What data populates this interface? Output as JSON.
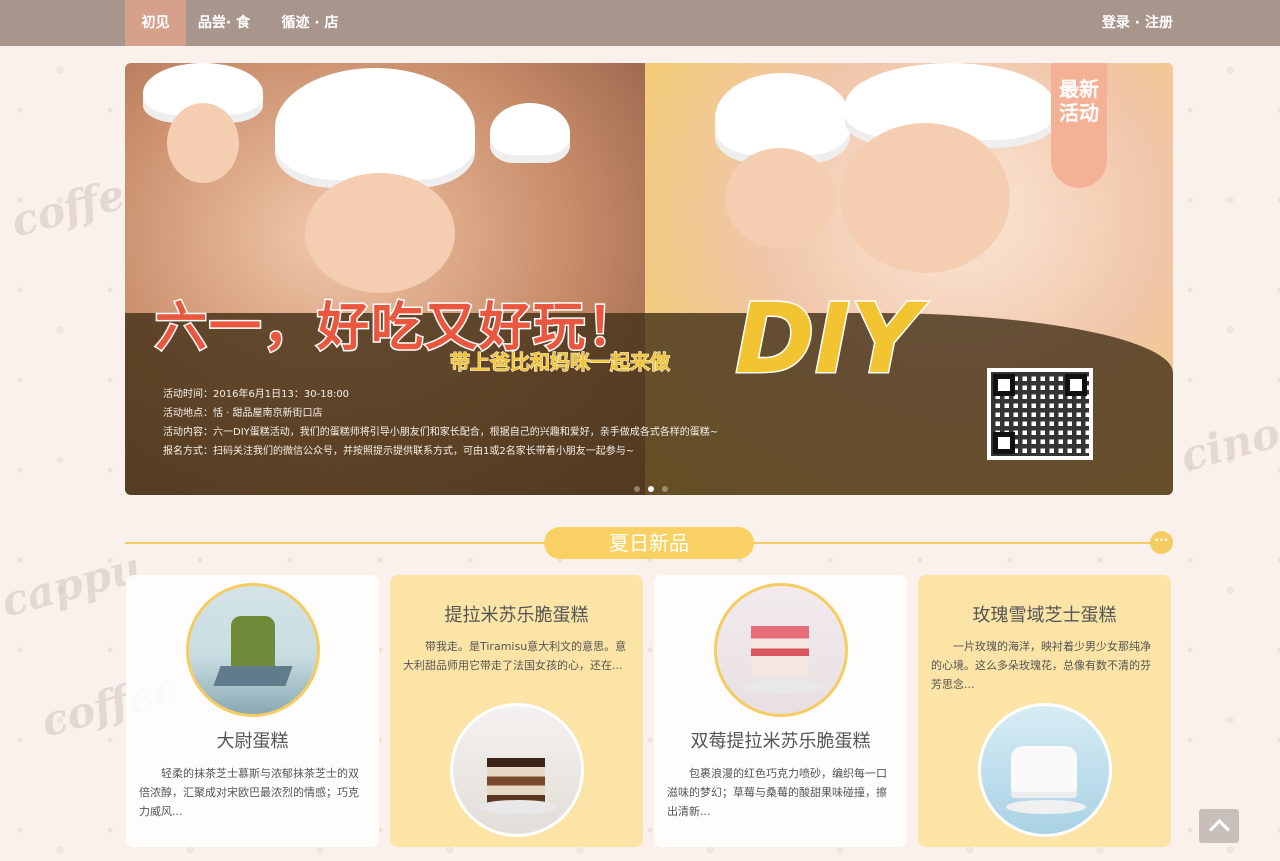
{
  "nav": {
    "items": [
      {
        "label": "初见",
        "active": true
      },
      {
        "label": "品尝· 食",
        "active": false
      },
      {
        "label": "循迹 · 店",
        "active": false
      }
    ],
    "login": "登录",
    "separator": " · ",
    "register": "注册"
  },
  "banner": {
    "badge": "最新活动",
    "headline": "六一，好吃又好玩！",
    "diy": "DIY",
    "subtitle": "带上爸比和妈咪一起来做",
    "info": [
      "活动时间：2016年6月1日13：30-18:00",
      "活动地点：恬 · 甜品屋南京新街口店",
      "活动内容：六一DIY蛋糕活动，我们的蛋糕师将引导小朋友们和家长配合，根据自己的兴趣和爱好，亲手做成各式各样的蛋糕~",
      "报名方式：扫码关注我们的微信公众号，并按照提示提供联系方式，可由1或2名家长带着小朋友一起参与~"
    ],
    "slide_count": 3,
    "active_slide": 2
  },
  "section": {
    "title": "夏日新品",
    "more": "···"
  },
  "products": [
    {
      "title": "大尉蛋糕",
      "desc": "轻柔的抹茶芝士慕斯与浓郁抹茶芝士的双倍浓醇，汇聚成对宋欧巴最浓烈的情感；巧克力威风..."
    },
    {
      "title": "提拉米苏乐脆蛋糕",
      "desc": "带我走。是Tiramisu意大利文的意思。意大利甜品师用它带走了法国女孩的心，还在..."
    },
    {
      "title": "双莓提拉米苏乐脆蛋糕",
      "desc": "包裹浪漫的红色巧克力喷砂，编织每一口滋味的梦幻；草莓与桑莓的酸甜果味碰撞，擦出清新..."
    },
    {
      "title": "玫瑰雪域芝士蛋糕",
      "desc": "一片玫瑰的海洋，映衬着少男少女那纯净的心境。这么多朵玫瑰花，总像有数不清的芬芳思念..."
    }
  ],
  "colors": {
    "nav_bg": "#a8958b",
    "nav_active": "#d6a18b",
    "accent_yellow": "#f5cc62",
    "badge": "#f4b196",
    "card_yellow": "#fbe4a6"
  }
}
